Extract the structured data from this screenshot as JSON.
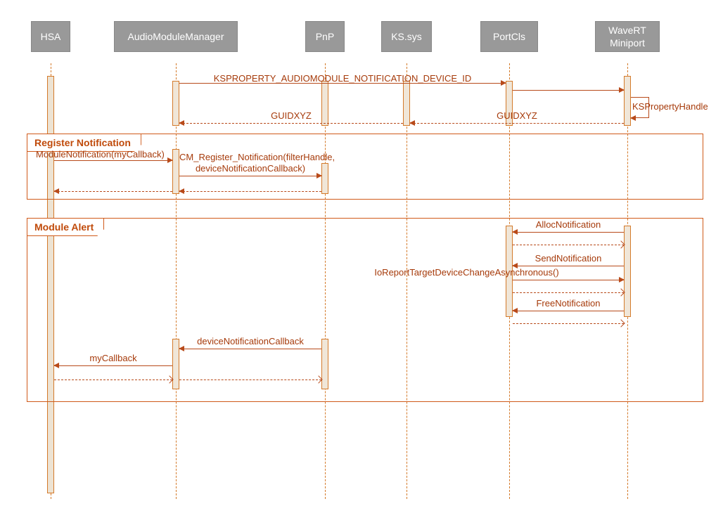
{
  "participants": {
    "hsa": "HSA",
    "amm": "AudioModuleManager",
    "pnp": "PnP",
    "ks": "KS.sys",
    "portcls": "PortCls",
    "wavert": "WaveRT\nMiniport"
  },
  "frames": {
    "register": "Register Notification",
    "alert": "Module Alert"
  },
  "messages": {
    "ksproperty": "KSPROPERTY_AUDIOMODULE_NOTIFICATION_DEVICE_ID",
    "ksprophandle": "KSPropertyHandle",
    "guidxyz1": "GUIDXYZ",
    "guidxyz2": "GUIDXYZ",
    "modulenotif": "ModuleNotification(myCallback)",
    "cmregister": "CM_Register_Notification(filterHandle,\ndeviceNotificationCallback)",
    "allocnotif": "AllocNotification",
    "sendnotif": "SendNotification",
    "ioreport": "IoReportTargetDeviceChangeAsynchronous()",
    "freenotif": "FreeNotification",
    "devnotifcb": "deviceNotificationCallback",
    "mycallback": "myCallback"
  }
}
